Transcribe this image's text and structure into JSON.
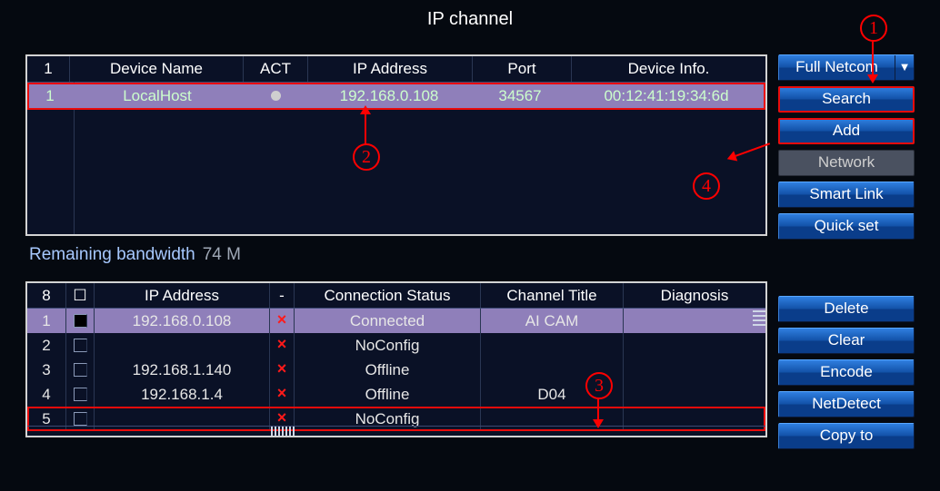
{
  "title": "IP channel",
  "dropdown": {
    "label": "Full Netcom"
  },
  "buttons_top": [
    "Search",
    "Add",
    "Network",
    "Smart Link",
    "Quick set"
  ],
  "buttons_bottom": [
    "Delete",
    "Clear",
    "Encode",
    "NetDetect",
    "Copy to"
  ],
  "device_table": {
    "headers": {
      "idx": "1",
      "name": "Device Name",
      "act": "ACT",
      "ip": "IP Address",
      "port": "Port",
      "info": "Device Info."
    },
    "row": {
      "idx": "1",
      "name": "LocalHost",
      "ip": "192.168.0.108",
      "port": "34567",
      "info": "00:12:41:19:34:6d"
    }
  },
  "bandwidth": {
    "label": "Remaining bandwidth",
    "value": "74 M"
  },
  "status_table": {
    "headers": {
      "num": "8",
      "ip": "IP Address",
      "del": "-",
      "con": "Connection Status",
      "title": "Channel Title",
      "diag": "Diagnosis"
    },
    "rows": [
      {
        "n": "1",
        "ip": "192.168.0.108",
        "con": "Connected",
        "title": "AI CAM",
        "sel": true,
        "chk": true
      },
      {
        "n": "2",
        "ip": "",
        "con": "NoConfig",
        "title": ""
      },
      {
        "n": "3",
        "ip": "192.168.1.140",
        "con": "Offline",
        "title": ""
      },
      {
        "n": "4",
        "ip": "192.168.1.4",
        "con": "Offline",
        "title": "D04"
      },
      {
        "n": "5",
        "ip": "",
        "con": "NoConfig",
        "title": "",
        "hl": true
      }
    ]
  },
  "callouts": {
    "c1": "1",
    "c2": "2",
    "c3": "3",
    "c4": "4"
  }
}
